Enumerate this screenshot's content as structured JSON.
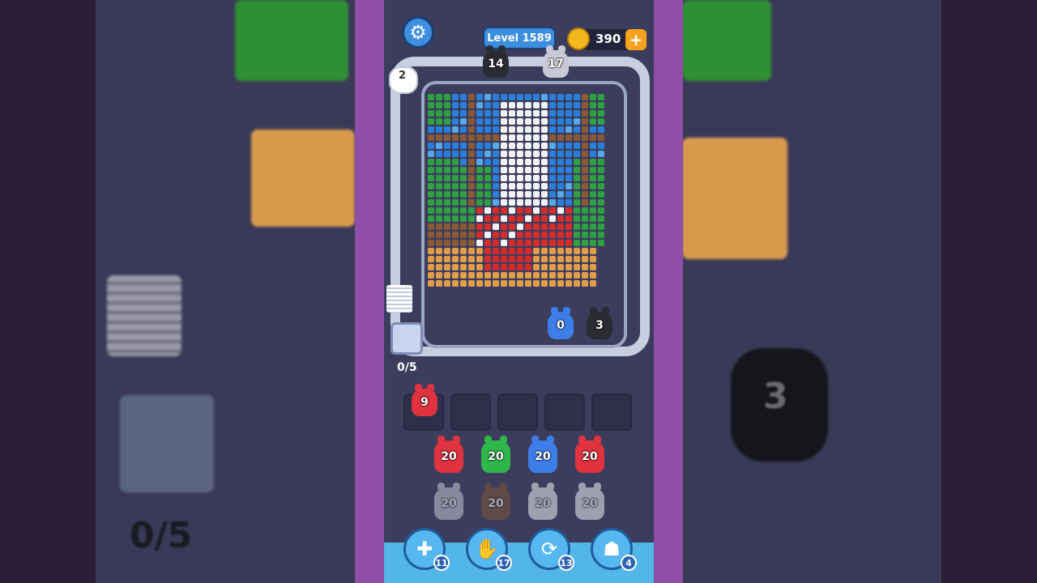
{
  "header": {
    "level_label": "Level 1589",
    "coins": "390",
    "coin_plus": "+"
  },
  "track": {
    "top_creatures": [
      {
        "count": "14",
        "color": "#2b2b33"
      },
      {
        "count": "17",
        "color": "#c9c9d6"
      }
    ],
    "hand_count": "2",
    "bottom_creatures": [
      {
        "count": "0",
        "color": "#3d7de8"
      },
      {
        "count": "3",
        "color": "#2b2b33"
      }
    ]
  },
  "progress": "0/5",
  "slots": {
    "filled": {
      "count": "9",
      "color": "#e0323f"
    }
  },
  "queue": {
    "row1": [
      {
        "count": "20",
        "color": "#e0323f"
      },
      {
        "count": "20",
        "color": "#2fb64a"
      },
      {
        "count": "20",
        "color": "#3d7de8"
      },
      {
        "count": "20",
        "color": "#e0323f"
      }
    ],
    "row2": [
      {
        "count": "20",
        "color": "#c5c7d4"
      },
      {
        "count": "20",
        "color": "#7a5536"
      },
      {
        "count": "20",
        "color": "#eef0f4"
      },
      {
        "count": "20",
        "color": "#eef0f4"
      }
    ]
  },
  "powerups": [
    {
      "icon": "add-card-icon",
      "glyph": "✚",
      "count": "11"
    },
    {
      "icon": "hand-icon",
      "glyph": "✋",
      "count": "17"
    },
    {
      "icon": "shuffle-icon",
      "glyph": "⟳",
      "count": "13"
    },
    {
      "icon": "creature-icon",
      "glyph": "☗",
      "count": "4"
    }
  ],
  "background": {
    "mirror_progress": "0/5",
    "mirror_count": "3"
  }
}
